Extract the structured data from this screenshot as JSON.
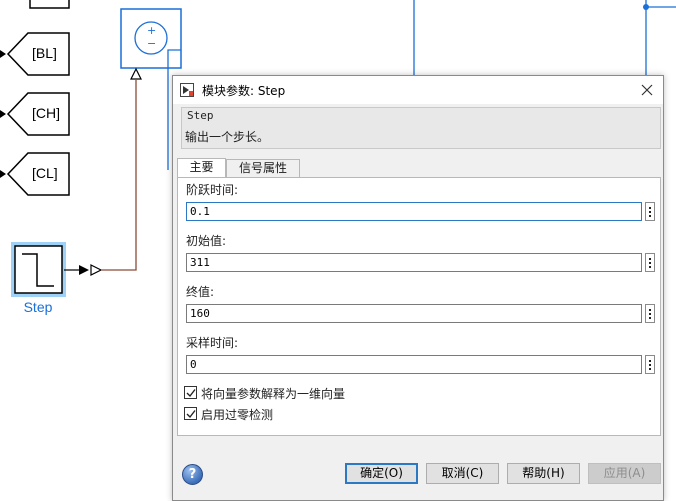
{
  "canvas": {
    "goto_tags": [
      "[BL]",
      "[CH]",
      "[CL]"
    ],
    "step_block_label": "Step",
    "sum_signs": [
      "+",
      "−"
    ]
  },
  "dialog": {
    "title": "模块参数: Step",
    "description": {
      "block_name": "Step",
      "text": "输出一个步长。"
    },
    "tabs": [
      {
        "label": "主要",
        "active": true
      },
      {
        "label": "信号属性",
        "active": false
      }
    ],
    "params": {
      "step_time": {
        "label": "阶跃时间:",
        "value": "0.1"
      },
      "initial_value": {
        "label": "初始值:",
        "value": "311"
      },
      "final_value": {
        "label": "终值:",
        "value": "160"
      },
      "sample_time": {
        "label": "采样时间:",
        "value": "0"
      }
    },
    "checkboxes": {
      "interpret_vector": {
        "label": "将向量参数解释为一维向量",
        "checked": true
      },
      "zero_crossing": {
        "label": "启用过零检测",
        "checked": true
      }
    },
    "buttons": {
      "ok": "确定(O)",
      "cancel": "取消(C)",
      "help": "帮助(H)",
      "apply": "应用(A)"
    },
    "help_icon_glyph": "?"
  },
  "colors": {
    "simulink_blue": "#1a6fd8",
    "signal_line": "#8b4a3a",
    "focus_blue": "#2b78c4"
  }
}
